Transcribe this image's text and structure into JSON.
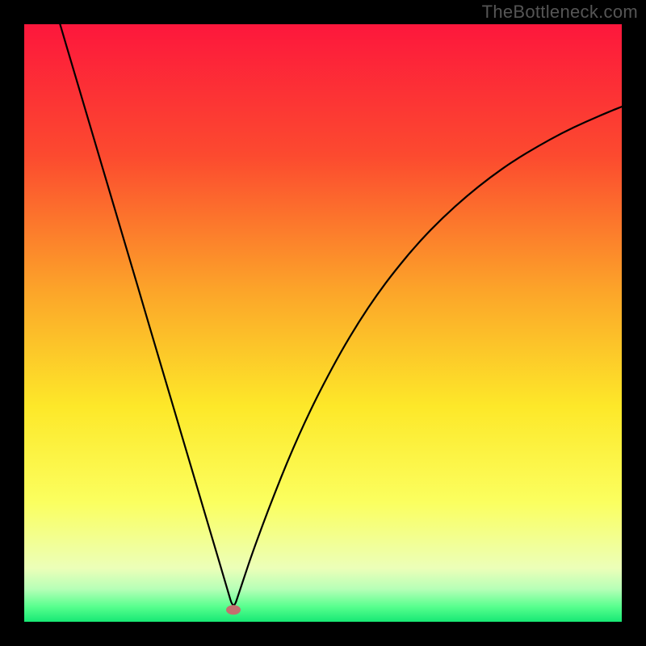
{
  "watermark": "TheBottleneck.com",
  "colors": {
    "frame": "#000000",
    "curve": "#000000",
    "marker": "#c46f6f",
    "gradient_stops": [
      {
        "offset": 0.0,
        "color": "#fd173c"
      },
      {
        "offset": 0.22,
        "color": "#fc4a2f"
      },
      {
        "offset": 0.45,
        "color": "#fca629"
      },
      {
        "offset": 0.64,
        "color": "#fde829"
      },
      {
        "offset": 0.8,
        "color": "#fbff5f"
      },
      {
        "offset": 0.91,
        "color": "#ecffb8"
      },
      {
        "offset": 0.945,
        "color": "#b7ffb7"
      },
      {
        "offset": 0.975,
        "color": "#57ff8e"
      },
      {
        "offset": 1.0,
        "color": "#17e874"
      }
    ]
  },
  "chart_data": {
    "type": "line",
    "title": "",
    "xlabel": "",
    "ylabel": "",
    "xlim": [
      0,
      100
    ],
    "ylim": [
      0,
      100
    ],
    "grid": false,
    "legend": false,
    "marker": {
      "x": 35,
      "y": 2
    },
    "x": [
      6,
      8,
      10,
      12,
      14,
      16,
      18,
      20,
      22,
      24,
      26,
      28,
      30,
      32,
      33,
      34,
      35,
      36,
      37,
      38,
      40,
      42,
      44,
      46,
      48,
      50,
      53,
      56,
      59,
      62,
      66,
      70,
      74,
      78,
      82,
      86,
      90,
      94,
      98,
      100
    ],
    "values": [
      100,
      93.2,
      86.5,
      79.7,
      73.0,
      66.2,
      59.5,
      52.7,
      45.9,
      39.2,
      32.4,
      25.7,
      18.9,
      12.2,
      8.8,
      5.4,
      2.0,
      5.0,
      8.0,
      11.0,
      16.5,
      21.7,
      26.7,
      31.3,
      35.6,
      39.6,
      45.2,
      50.2,
      54.7,
      58.7,
      63.5,
      67.6,
      71.2,
      74.4,
      77.2,
      79.6,
      81.8,
      83.7,
      85.4,
      86.2
    ]
  }
}
